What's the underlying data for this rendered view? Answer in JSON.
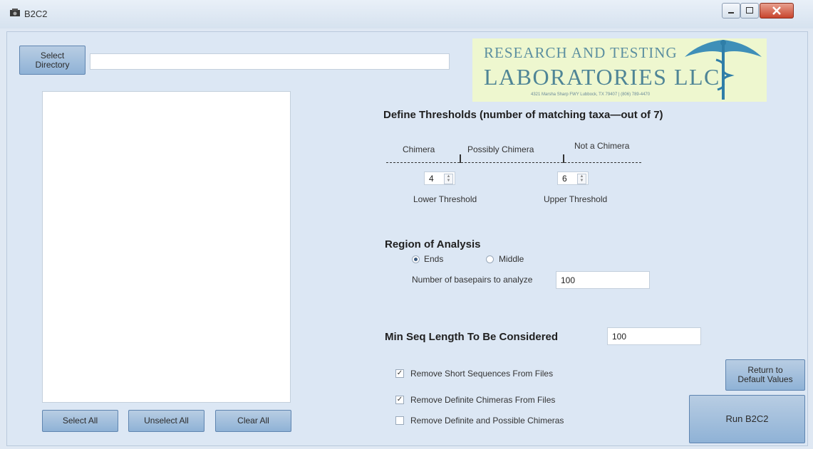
{
  "window": {
    "title": "B2C2",
    "controls": [
      "minimize",
      "maximize",
      "close"
    ]
  },
  "directory": {
    "button_label": "Select Directory",
    "path_value": ""
  },
  "file_list": {
    "items": []
  },
  "list_buttons": {
    "select_all": "Select All",
    "unselect_all": "Unselect All",
    "clear_all": "Clear All"
  },
  "logo": {
    "line1": "RESEARCH AND TESTING",
    "line2": "LABORATORIES LLC.",
    "line3": "4321 Marsha Sharp FWY  Lubbock, TX 79407  |  (806) 789-4470"
  },
  "thresholds": {
    "heading": "Define Thresholds (number of matching taxa—out of 7)",
    "zone_chimera": "Chimera",
    "zone_possibly": "Possibly Chimera",
    "zone_not": "Not a Chimera",
    "lower_value": "4",
    "upper_value": "6",
    "lower_label": "Lower Threshold",
    "upper_label": "Upper Threshold"
  },
  "region": {
    "heading": "Region of Analysis",
    "option_ends": "Ends",
    "option_middle": "Middle",
    "selected": "Ends",
    "bp_label": "Number of basepairs to analyze",
    "bp_value": "100"
  },
  "min_seq": {
    "label": "Min Seq Length To Be Considered",
    "value": "100"
  },
  "options": {
    "remove_short": {
      "label": "Remove Short Sequences From Files",
      "checked": true
    },
    "remove_definite": {
      "label": "Remove Definite Chimeras From Files",
      "checked": true
    },
    "remove_both": {
      "label": "Remove Definite and Possible Chimeras",
      "checked": false
    }
  },
  "actions": {
    "return_default": "Return to Default Values",
    "run": "Run B2C2"
  },
  "colors": {
    "button": "#9fbedf",
    "background": "#dce7f4",
    "logo_bg": "#eef7cf",
    "logo_text": "#4f8596"
  }
}
